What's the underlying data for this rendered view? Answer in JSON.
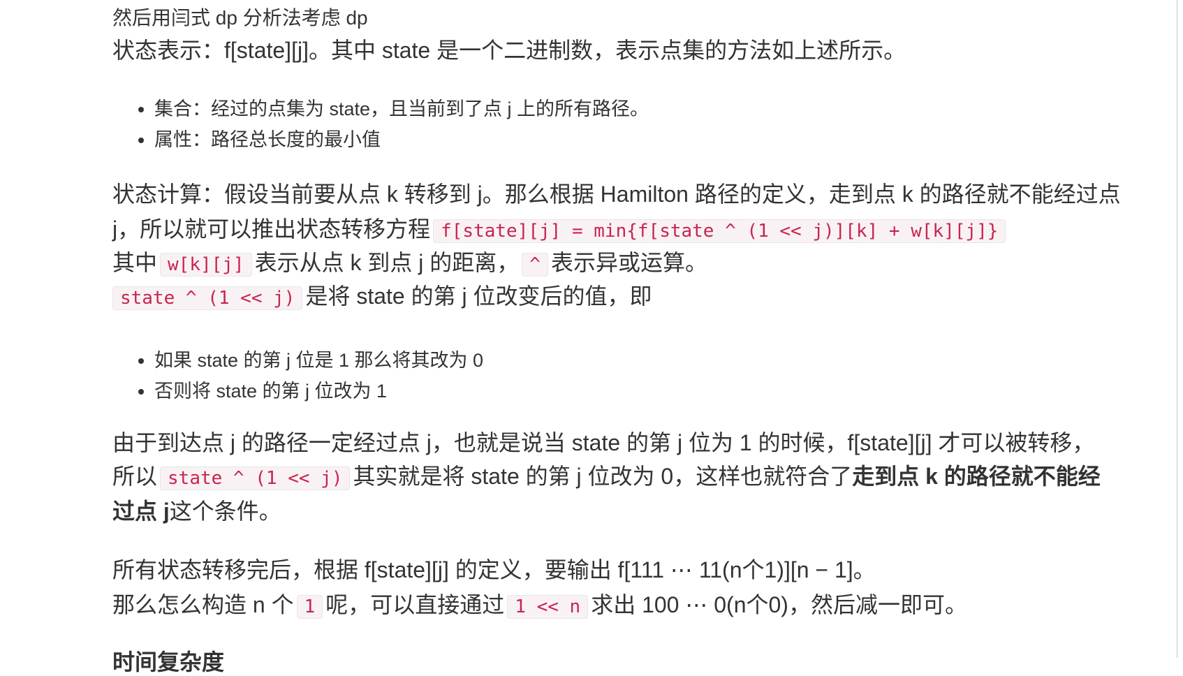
{
  "heading_top": "然后用闫式 dp 分析法考虑 dp",
  "state_repr": {
    "label": "状态表示：",
    "math": "f[state][j]",
    "rest": "。其中 state 是一个二进制数，表示点集的方法如上述所示。"
  },
  "bullets_1": [
    "集合：经过的点集为 state，且当前到了点 j 上的所有路径。",
    "属性：路径总长度的最小值"
  ],
  "state_calc": {
    "line1": "状态计算：假设当前要从点 k 转移到 j。那么根据 Hamilton 路径的定义，走到点 k 的路径就不能经过点",
    "line2_prefix": "j，所以就可以推出状态转移方程",
    "line2_code": "f[state][j] = min{f[state ^ (1 << j)][k] + w[k][j]}",
    "line3_prefix": "其中",
    "line3_code1": "w[k][j]",
    "line3_mid": "表示从点 k 到点 j 的距离，",
    "line3_code2": "^",
    "line3_suffix": "表示异或运算。",
    "line4_code": "state ^ (1 << j)",
    "line4_suffix": "是将 state 的第 j 位改变后的值，即"
  },
  "bullets_2": [
    "如果 state 的第 j 位是 1 那么将其改为 0",
    "否则将 state 的第 j 位改为 1"
  ],
  "explain": {
    "line1": "由于到达点 j 的路径一定经过点 j，也就是说当 state 的第 j 位为 1 的时候，f[state][j] 才可以被转移，",
    "line2_prefix": "所以",
    "line2_code": "state ^ (1 << j)",
    "line2_mid": "其实就是将 state 的第 j 位改为 0，这样也就符合了",
    "line2_bold": "走到点 k 的路径就不能经",
    "line3_bold": "过点 j",
    "line3_suffix": "这个条件。"
  },
  "final": {
    "line1": "所有状态转移完后，根据 f[state][j] 的定义，要输出 f[111 ⋯ 11(n个1)][n − 1]。",
    "line2_prefix": "那么怎么构造 n 个",
    "line2_code1": "1",
    "line2_mid": "呢，可以直接通过",
    "line2_code2": "1 << n",
    "line2_suffix": "求出 100 ⋯ 0(n个0)，然后减一即可。"
  },
  "cut_heading": "时间复杂度"
}
